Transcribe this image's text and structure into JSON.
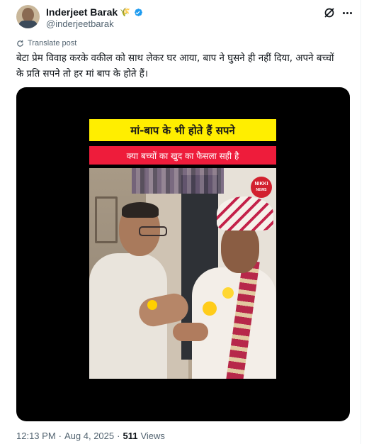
{
  "author": {
    "display_name": "Inderjeet Barak",
    "handle": "@inderjeetbarak",
    "verified": true
  },
  "translate_label": "Translate post",
  "post_text": "बेटा प्रेम विवाह करके वकील को साथ लेकर घर आया, बाप ने घुसने ही नहीं दिया, अपने बच्चों के प्रति सपने तो हर मां बाप के होते हैं।",
  "media": {
    "banner_top": "मां-बाप के भी होते हैं सपने",
    "banner_bottom": "क्या बच्चों का खुद का फैसला सही है",
    "logo_line1": "NIKKI",
    "logo_line2": "NEWS"
  },
  "meta": {
    "time": "12:13 PM",
    "separator": "·",
    "date": "Aug 4, 2025",
    "separator2": "·",
    "views_count": "511",
    "views_label": "Views"
  },
  "colors": {
    "verified": "#1d9bf0",
    "banner_top_bg": "#ffee00",
    "banner_bottom_bg": "#ee1c3b"
  }
}
